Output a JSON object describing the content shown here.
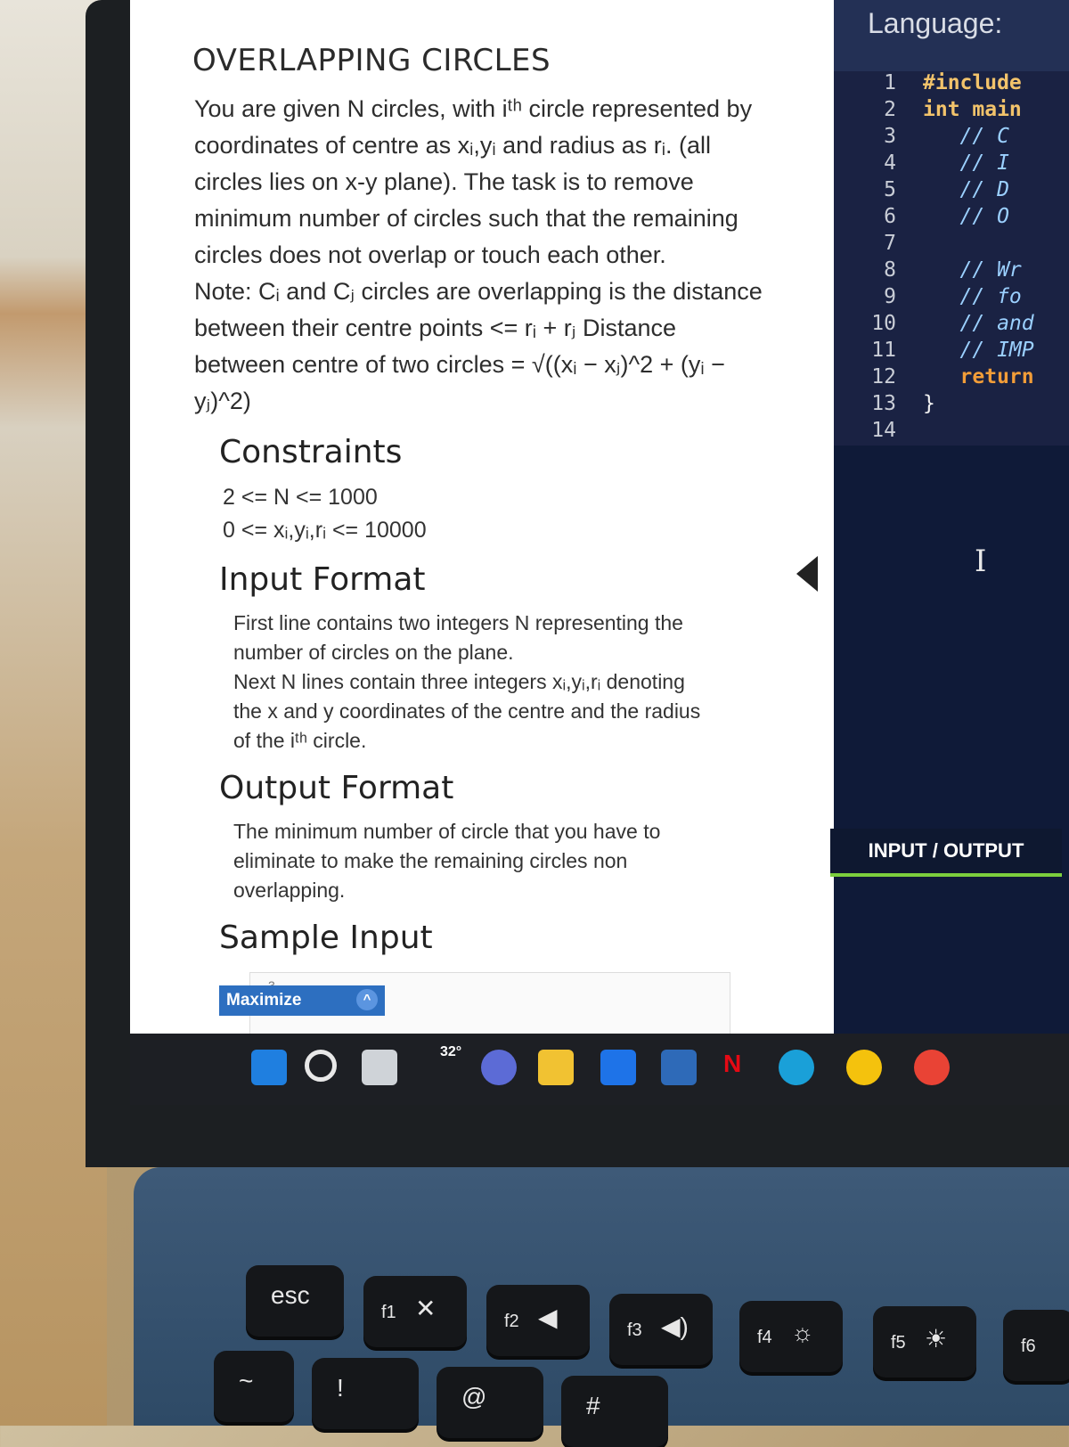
{
  "problem": {
    "title": "OVERLAPPING CIRCLES",
    "description_lines": [
      "You are given N circles, with iᵗʰ circle represented by",
      "coordinates of centre as xᵢ,yᵢ and radius as rᵢ. (all",
      "circles lies on x-y plane). The task is to remove",
      "minimum number of circles such that the remaining",
      "circles does not overlap or touch each other.",
      "Note: Cᵢ and Cⱼ circles are overlapping is the distance",
      "between their centre points <= rᵢ + rⱼ Distance",
      "between centre of two circles = √((xᵢ − xⱼ)^2 + (yᵢ −",
      "yⱼ)^2)"
    ],
    "constraints_heading": "Constraints",
    "constraints": [
      "2 <= N <= 1000",
      "0 <= xᵢ,yᵢ,rᵢ <= 10000"
    ],
    "input_heading": "Input Format",
    "input_lines": [
      "First line contains two integers N representing the",
      "number of circles on the plane.",
      "Next N lines contain three integers xᵢ,yᵢ,rᵢ denoting",
      "the x and y coordinates of the centre and the radius",
      "of the iᵗʰ circle."
    ],
    "output_heading": "Output Format",
    "output_lines": [
      "The minimum number of circle that you have to",
      "eliminate to make the remaining circles non",
      "overlapping."
    ],
    "sample_heading": "Sample Input",
    "sample_first_line": "3"
  },
  "editor": {
    "language_label": "Language:",
    "line_numbers": [
      "1",
      "2",
      "3",
      "4",
      "5",
      "6",
      "7",
      "8",
      "9",
      "10",
      "11",
      "12",
      "13",
      "14"
    ],
    "code_lines": [
      "#include",
      "int main",
      "   // C",
      "   // I",
      "   // D",
      "   // O",
      "",
      "   // Wr",
      "   // fo",
      "   // and",
      "   // IMP",
      "   return",
      "}",
      ""
    ],
    "io_tab_label": "INPUT / OUTPUT"
  },
  "taskbar": {
    "maximize_label": "Maximize",
    "weather": "32°"
  },
  "keyboard": {
    "esc": "esc",
    "f1": "f1",
    "f2": "f2",
    "f3": "f3",
    "f4": "f4",
    "f5": "f5",
    "f6": "f6",
    "row2": [
      "~",
      "!",
      "@",
      "#"
    ]
  }
}
